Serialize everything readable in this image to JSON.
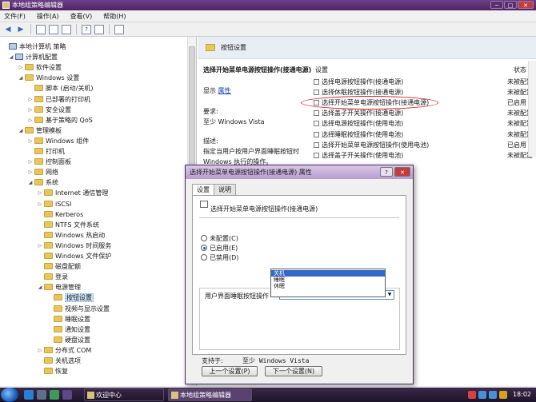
{
  "window": {
    "title": "本地组策略编辑器",
    "min": "─",
    "max": "□",
    "close": "✕"
  },
  "menu": [
    "文件(F)",
    "操作(A)",
    "查看(V)",
    "帮助(H)"
  ],
  "toolbar": {
    "back": "◀",
    "forward": "▶",
    "help": "?"
  },
  "tree": [
    {
      "label": "本地计算机 策略",
      "exp": "",
      "icon": "comp"
    },
    {
      "label": "计算机配置",
      "exp": "◢",
      "icon": "comp"
    },
    {
      "label": "软件设置",
      "exp": "▷",
      "icon": "folder"
    },
    {
      "label": "Windows 设置",
      "exp": "◢",
      "icon": "folder"
    },
    {
      "label": "脚本 (启动/关机)",
      "exp": "",
      "icon": "folder"
    },
    {
      "label": "已部署的打印机",
      "exp": "▷",
      "icon": "folder"
    },
    {
      "label": "安全设置",
      "exp": "▷",
      "icon": "folder"
    },
    {
      "label": "基于策略的 QoS",
      "exp": "▷",
      "icon": "folder"
    },
    {
      "label": "管理模板",
      "exp": "◢",
      "icon": "folder"
    },
    {
      "label": "Windows 组件",
      "exp": "▷",
      "icon": "folder"
    },
    {
      "label": "打印机",
      "exp": "",
      "icon": "folder"
    },
    {
      "label": "控制面板",
      "exp": "▷",
      "icon": "folder"
    },
    {
      "label": "网络",
      "exp": "▷",
      "icon": "folder"
    },
    {
      "label": "系统",
      "exp": "◢",
      "icon": "folder"
    },
    {
      "label": "Internet 通信管理",
      "exp": "▷",
      "icon": "folder"
    },
    {
      "label": "iSCSI",
      "exp": "▷",
      "icon": "folder"
    },
    {
      "label": "Kerberos",
      "exp": "",
      "icon": "folder"
    },
    {
      "label": "NTFS 文件系统",
      "exp": "",
      "icon": "folder"
    },
    {
      "label": "Windows 热启动",
      "exp": "",
      "icon": "folder"
    },
    {
      "label": "Windows 时间服务",
      "exp": "▷",
      "icon": "folder"
    },
    {
      "label": "Windows 文件保护",
      "exp": "",
      "icon": "folder"
    },
    {
      "label": "磁盘配额",
      "exp": "",
      "icon": "folder"
    },
    {
      "label": "登录",
      "exp": "",
      "icon": "folder"
    },
    {
      "label": "电源管理",
      "exp": "◢",
      "icon": "folder"
    },
    {
      "label": "按钮设置",
      "exp": "",
      "icon": "folder",
      "selected": true
    },
    {
      "label": "视频与显示设置",
      "exp": "",
      "icon": "folder"
    },
    {
      "label": "睡眠设置",
      "exp": "",
      "icon": "folder"
    },
    {
      "label": "通知设置",
      "exp": "",
      "icon": "folder"
    },
    {
      "label": "硬盘设置",
      "exp": "",
      "icon": "folder"
    },
    {
      "label": "分布式 COM",
      "exp": "▷",
      "icon": "folder"
    },
    {
      "label": "关机选项",
      "exp": "",
      "icon": "folder"
    },
    {
      "label": "恢复",
      "exp": "",
      "icon": "folder"
    }
  ],
  "right": {
    "header": "按钮设置",
    "policy_title": "选择开始菜单电源按钮操作(接通电源)",
    "show_label": "显示",
    "show_link": "属性",
    "req_label": "要求:",
    "req_value": "至少 Windows Vista",
    "desc_label": "描述:",
    "desc_line1": "指定当用户按用户界面睡眠按钮时",
    "desc_line2": "Windows 执行的操作。",
    "col_setting": "设置",
    "col_state": "状态",
    "rows": [
      {
        "name": "选择电源按钮操作(接通电源)",
        "state": "未被配置"
      },
      {
        "name": "选择休眠按钮操作(接通电源)",
        "state": "未被配置"
      },
      {
        "name": "选择开始菜单电源按钮操作(接通电源)",
        "state": "已启用"
      },
      {
        "name": "选择盖子开关操作(接通电源)",
        "state": "未被配置"
      },
      {
        "name": "选择电源按钮操作(使用电池)",
        "state": "未被配置"
      },
      {
        "name": "选择睡眠按钮操作(使用电池)",
        "state": "未被配置"
      },
      {
        "name": "选择开始菜单电源按钮操作(使用电池)",
        "state": "已启用"
      },
      {
        "name": "选择盖子开关操作(使用电池)",
        "state": "未被配置"
      }
    ]
  },
  "dialog": {
    "title": "选择开始菜单电源按钮操作(接通电源) 属性",
    "help": "?",
    "close": "✕",
    "tabs": [
      "设置",
      "说明"
    ],
    "policy_name": "选择开始菜单电源按钮操作(接通电源)",
    "radios": [
      "未配置(C)",
      "已启用(E)",
      "已禁用(D)"
    ],
    "selected_radio": 1,
    "option_label": "用户界面睡眠按钮操作",
    "select_value": "关机",
    "select_arrow": "▼",
    "dropdown_options": [
      "关机",
      "睡眠",
      "休眠"
    ],
    "support_label": "支持于:",
    "support_value": "至少 Windows Vista",
    "prev_button": "上一个设置(P)",
    "next_button": "下一个设置(N)"
  },
  "taskbar": {
    "tasks": [
      "欢迎中心",
      "本地组策略编辑器"
    ],
    "clock": "18:02"
  }
}
